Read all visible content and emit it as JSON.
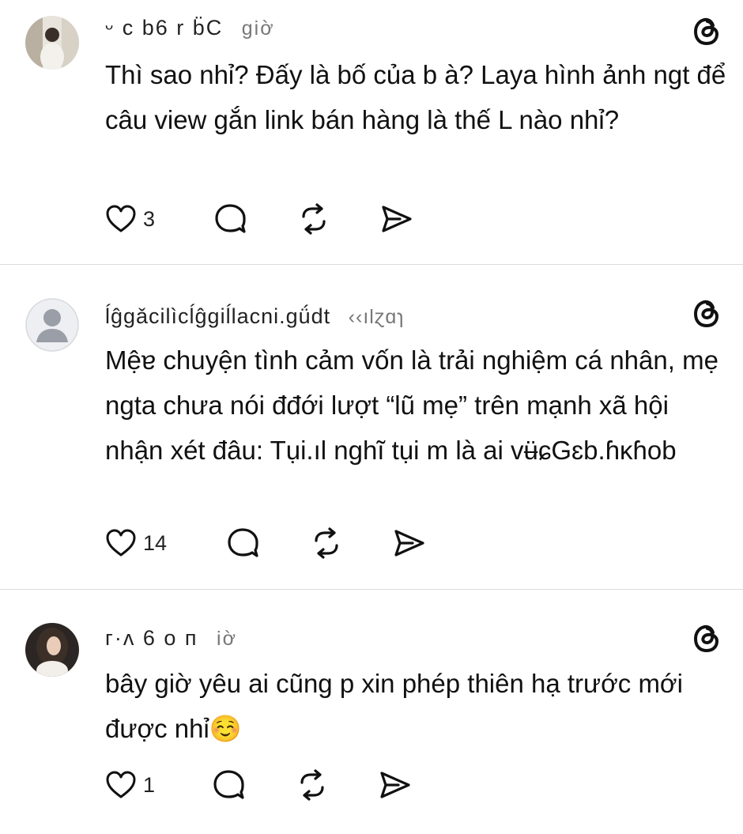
{
  "posts": [
    {
      "username": "ᵕ c   b6 r b̈C",
      "time": "giờ",
      "text": "Thì sao nhỉ? Đấy là bố của b à? Laya hình ảnh ngt để câu view gắn link bán hàng là thế L nào nhỉ?",
      "likes": "3",
      "avatar_style": "photo-light"
    },
    {
      "username": "ĺĝgǎcilìcĺĝgiĺlacni.gǘdt",
      "time": "‹‹ılɀɑɿ",
      "text": "Mệɐ chuyện tình cảm vốn là trải nghiệm cá nhân, mẹ ngta chưa nói đđới lượt “lũ mẹ” trên mạnh xã hội nhận xét đâu: Tụi.ıl nghĩ tụi m là ai vʉ̈ɕGɛb.ɦĸɦob",
      "likes": "14",
      "avatar_style": "default"
    },
    {
      "username": "ᴦ·ᴧ   6 o ᴨ",
      "time": "iờ",
      "text": "bây giờ yêu ai cũng p xin phép thiên hạ trước mới được nhỉ☺️",
      "likes": "1",
      "avatar_style": "photo-dark"
    }
  ],
  "icons": {
    "like": "heart-icon",
    "reply": "comment-icon",
    "repost": "repost-icon",
    "share": "share-icon",
    "brand": "threads-logo"
  }
}
